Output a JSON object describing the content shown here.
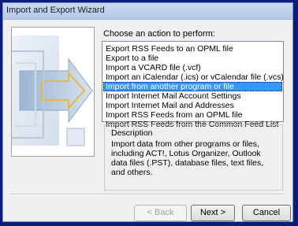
{
  "window": {
    "title": "Import and Export Wizard"
  },
  "main": {
    "prompt": "Choose an action to perform:",
    "actions": [
      "Export RSS Feeds to an OPML file",
      "Export to a file",
      "Import a VCARD file (.vcf)",
      "Import an iCalendar (.ics) or vCalendar file (.vcs)",
      "Import from another program or file",
      "Import Internet Mail Account Settings",
      "Import Internet Mail and Addresses",
      "Import RSS Feeds from an OPML file",
      "Import RSS Feeds from the Common Feed List"
    ],
    "selected_index": 4,
    "description": {
      "title": "Description",
      "text": "Import data from other programs or files, including ACT!, Lotus Organizer, Outlook data files (.PST), database files, text files, and others."
    }
  },
  "footer": {
    "back_label": "< Back",
    "next_label": "Next >",
    "cancel_label": "Cancel"
  },
  "colors": {
    "frame": "#0b1d7a",
    "selection": "#3399ff",
    "window_bg": "#f0f0f0"
  },
  "icons": {
    "wizard_art": "import-export-arrows-icon"
  }
}
